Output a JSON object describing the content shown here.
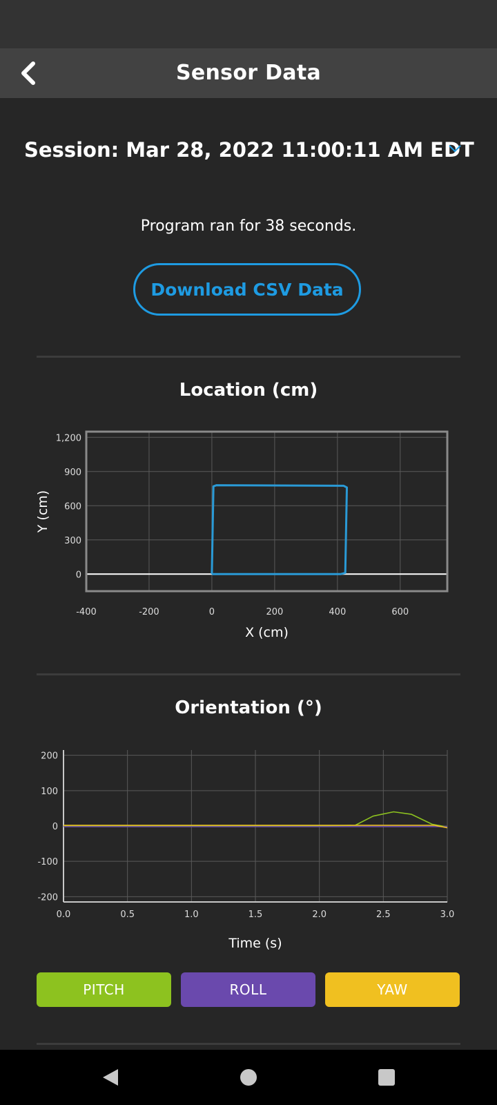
{
  "header": {
    "title": "Sensor Data",
    "back_icon": "chevron-left-icon"
  },
  "session": {
    "label": "Session: Mar 28, 2022 11:00:11 AM EDT",
    "dropdown_icon": "chevron-down-icon"
  },
  "runtime_text": "Program ran for 38 seconds.",
  "download_button": "Download CSV Data",
  "location": {
    "title": "Location (cm)",
    "chart_data": {
      "type": "line",
      "xlabel": "X (cm)",
      "ylabel": "Y (cm)",
      "xlim": [
        -400,
        750
      ],
      "ylim": [
        -150,
        1250
      ],
      "x_ticks": [
        "-400",
        "-200",
        "0",
        "200",
        "400",
        "600"
      ],
      "x_tick_values": [
        -400,
        -200,
        0,
        200,
        400,
        600
      ],
      "y_ticks": [
        "0",
        "300",
        "600",
        "900",
        "1,200"
      ],
      "y_tick_values": [
        0,
        300,
        600,
        900,
        1200
      ],
      "series": [
        {
          "color": "#2a9ad6",
          "x": [
            0,
            5,
            15,
            420,
            430,
            425,
            410,
            0
          ],
          "y": [
            0,
            770,
            780,
            775,
            760,
            10,
            0,
            0
          ]
        }
      ],
      "grid": true
    }
  },
  "orientation": {
    "title": "Orientation (°)",
    "chart_data": {
      "type": "line",
      "xlabel": "Time (s)",
      "ylabel": "",
      "xlim": [
        0,
        3.0
      ],
      "ylim": [
        -215,
        215
      ],
      "x_ticks": [
        "0.0",
        "0.5",
        "1.0",
        "1.5",
        "2.0",
        "2.5",
        "3.0"
      ],
      "x_tick_values": [
        0,
        0.5,
        1.0,
        1.5,
        2.0,
        2.5,
        3.0
      ],
      "y_ticks": [
        "200",
        "100",
        "0",
        "-100",
        "-200"
      ],
      "y_tick_values": [
        200,
        100,
        0,
        -100,
        -200
      ],
      "series": [
        {
          "name": "PITCH",
          "color": "#8dc21f",
          "x": [
            0,
            2.0,
            2.28,
            2.42,
            2.58,
            2.72,
            2.88,
            3.0
          ],
          "y": [
            0,
            0,
            2,
            28,
            40,
            33,
            5,
            -3
          ]
        },
        {
          "name": "ROLL",
          "color": "#6a49ad",
          "x": [
            0,
            3.0
          ],
          "y": [
            -2,
            -2
          ]
        },
        {
          "name": "YAW",
          "color": "#f0c020",
          "x": [
            0,
            2.9,
            3.0
          ],
          "y": [
            2,
            2,
            -5
          ]
        }
      ],
      "grid": true
    },
    "toggles": [
      {
        "label": "PITCH",
        "color": "#8dc21f"
      },
      {
        "label": "ROLL",
        "color": "#6a49ad"
      },
      {
        "label": "YAW",
        "color": "#f0c020"
      }
    ]
  },
  "nav": {
    "back_icon": "triangle-back-icon",
    "home_icon": "circle-home-icon",
    "recents_icon": "square-recents-icon"
  }
}
